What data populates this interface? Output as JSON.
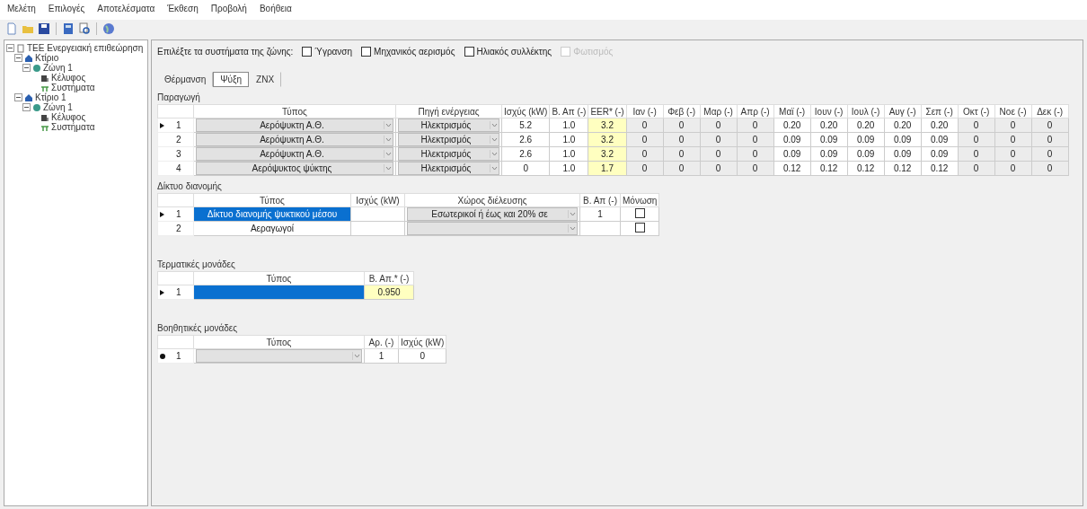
{
  "menu": [
    "Μελέτη",
    "Επιλογές",
    "Αποτελέσματα",
    "Έκθεση",
    "Προβολή",
    "Βοήθεια"
  ],
  "tree": [
    {
      "label": "ΤΕΕ Ενεργειακή επιθεώρηση",
      "kind": "root",
      "expanded": true,
      "children": [
        {
          "label": "Κτίριο",
          "kind": "building",
          "expanded": true,
          "children": [
            {
              "label": "Ζώνη 1",
              "kind": "zone",
              "expanded": true,
              "children": [
                {
                  "label": "Κέλυφος",
                  "kind": "shell"
                },
                {
                  "label": "Συστήματα",
                  "kind": "systems"
                }
              ]
            }
          ]
        },
        {
          "label": "Κτίριο 1",
          "kind": "building",
          "expanded": true,
          "children": [
            {
              "label": "Ζώνη 1",
              "kind": "zone",
              "expanded": true,
              "children": [
                {
                  "label": "Κέλυφος",
                  "kind": "shell"
                },
                {
                  "label": "Συστήματα",
                  "kind": "systems"
                }
              ]
            }
          ]
        }
      ]
    }
  ],
  "systems_prompt": "Επιλέξτε τα συστήματα της ζώνης:",
  "system_options": [
    {
      "label": "Ύγρανση",
      "checked": false,
      "disabled": false
    },
    {
      "label": "Μηχανικός αερισμός",
      "checked": false,
      "disabled": false
    },
    {
      "label": "Ηλιακός συλλέκτης",
      "checked": false,
      "disabled": false
    },
    {
      "label": "Φωτισμός",
      "checked": false,
      "disabled": true
    }
  ],
  "tabs": [
    {
      "label": "Θέρμανση",
      "selected": false
    },
    {
      "label": "Ψύξη",
      "selected": true
    },
    {
      "label": "ΖΝΧ",
      "selected": false
    }
  ],
  "sections": [
    {
      "title": "Παραγωγή",
      "columns": [
        {
          "label": "Τύπος",
          "kind": "combo"
        },
        {
          "label": "Πηγή ενέργειας",
          "kind": "combo"
        },
        {
          "label": "Ισχύς (kW)",
          "kind": "text"
        },
        {
          "label": "Β. Απ (-)",
          "kind": "text"
        },
        {
          "label": "EER* (-)",
          "kind": "yellow"
        },
        {
          "label": "Ιαν (-)",
          "kind": "gray"
        },
        {
          "label": "Φεβ (-)",
          "kind": "gray"
        },
        {
          "label": "Μαρ (-)",
          "kind": "gray"
        },
        {
          "label": "Απρ (-)",
          "kind": "gray"
        },
        {
          "label": "Μαϊ (-)",
          "kind": "text"
        },
        {
          "label": "Ιουν (-)",
          "kind": "text"
        },
        {
          "label": "Ιουλ (-)",
          "kind": "text"
        },
        {
          "label": "Αυγ (-)",
          "kind": "text"
        },
        {
          "label": "Σεπ (-)",
          "kind": "text"
        },
        {
          "label": "Οκτ (-)",
          "kind": "gray"
        },
        {
          "label": "Νοε (-)",
          "kind": "gray"
        },
        {
          "label": "Δεκ (-)",
          "kind": "gray"
        }
      ],
      "rows": [
        {
          "number": "1",
          "current": true,
          "selected": false,
          "cells": [
            "Αερόψυκτη Α.Θ.",
            "Ηλεκτρισμός",
            "5.2",
            "1.0",
            "3.2",
            "0",
            "0",
            "0",
            "0",
            "0.20",
            "0.20",
            "0.20",
            "0.20",
            "0.20",
            "0",
            "0",
            "0"
          ]
        },
        {
          "number": "2",
          "current": false,
          "selected": false,
          "cells": [
            "Αερόψυκτη Α.Θ.",
            "Ηλεκτρισμός",
            "2.6",
            "1.0",
            "3.2",
            "0",
            "0",
            "0",
            "0",
            "0.09",
            "0.09",
            "0.09",
            "0.09",
            "0.09",
            "0",
            "0",
            "0"
          ]
        },
        {
          "number": "3",
          "current": false,
          "selected": false,
          "cells": [
            "Αερόψυκτη Α.Θ.",
            "Ηλεκτρισμός",
            "2.6",
            "1.0",
            "3.2",
            "0",
            "0",
            "0",
            "0",
            "0.09",
            "0.09",
            "0.09",
            "0.09",
            "0.09",
            "0",
            "0",
            "0"
          ]
        },
        {
          "number": "4",
          "current": false,
          "selected": false,
          "cells": [
            "Αερόψυκτος ψύκτης",
            "Ηλεκτρισμός",
            "0",
            "1.0",
            "1.7",
            "0",
            "0",
            "0",
            "0",
            "0.12",
            "0.12",
            "0.12",
            "0.12",
            "0.12",
            "0",
            "0",
            "0"
          ]
        }
      ]
    },
    {
      "title": "Δίκτυο διανομής",
      "columns": [
        {
          "label": "Τύπος",
          "kind": "text"
        },
        {
          "label": "Ισχύς (kW)",
          "kind": "text"
        },
        {
          "label": "Χώρος διέλευσης",
          "kind": "combo"
        },
        {
          "label": "Β. Απ (-)",
          "kind": "text"
        },
        {
          "label": "Μόνωση",
          "kind": "check"
        }
      ],
      "rows": [
        {
          "number": "1",
          "current": true,
          "selected": true,
          "cells": [
            "Δίκτυο διανομής ψυκτικού μέσου",
            "",
            "Εσωτερικοί ή έως και 20% σε",
            "1",
            false
          ]
        },
        {
          "number": "2",
          "current": false,
          "selected": false,
          "cells": [
            "Αεραγωγοί",
            "",
            "",
            "",
            false
          ]
        }
      ]
    },
    {
      "title": "Τερματικές μονάδες",
      "columns": [
        {
          "label": "Τύπος",
          "kind": "text"
        },
        {
          "label": "Β. Απ.* (-)",
          "kind": "yellow"
        }
      ],
      "rows": [
        {
          "number": "1",
          "current": true,
          "selected": true,
          "cells": [
            "",
            "0.950"
          ]
        }
      ]
    },
    {
      "title": "Βοηθητικές μονάδες",
      "columns": [
        {
          "label": "Τύπος",
          "kind": "combo"
        },
        {
          "label": "Αρ. (-)",
          "kind": "text"
        },
        {
          "label": "Ισχύς (kW)",
          "kind": "text"
        }
      ],
      "rows": [
        {
          "number": "1",
          "new_row": true,
          "selected": false,
          "cells": [
            "",
            "1",
            "0"
          ]
        }
      ]
    }
  ]
}
